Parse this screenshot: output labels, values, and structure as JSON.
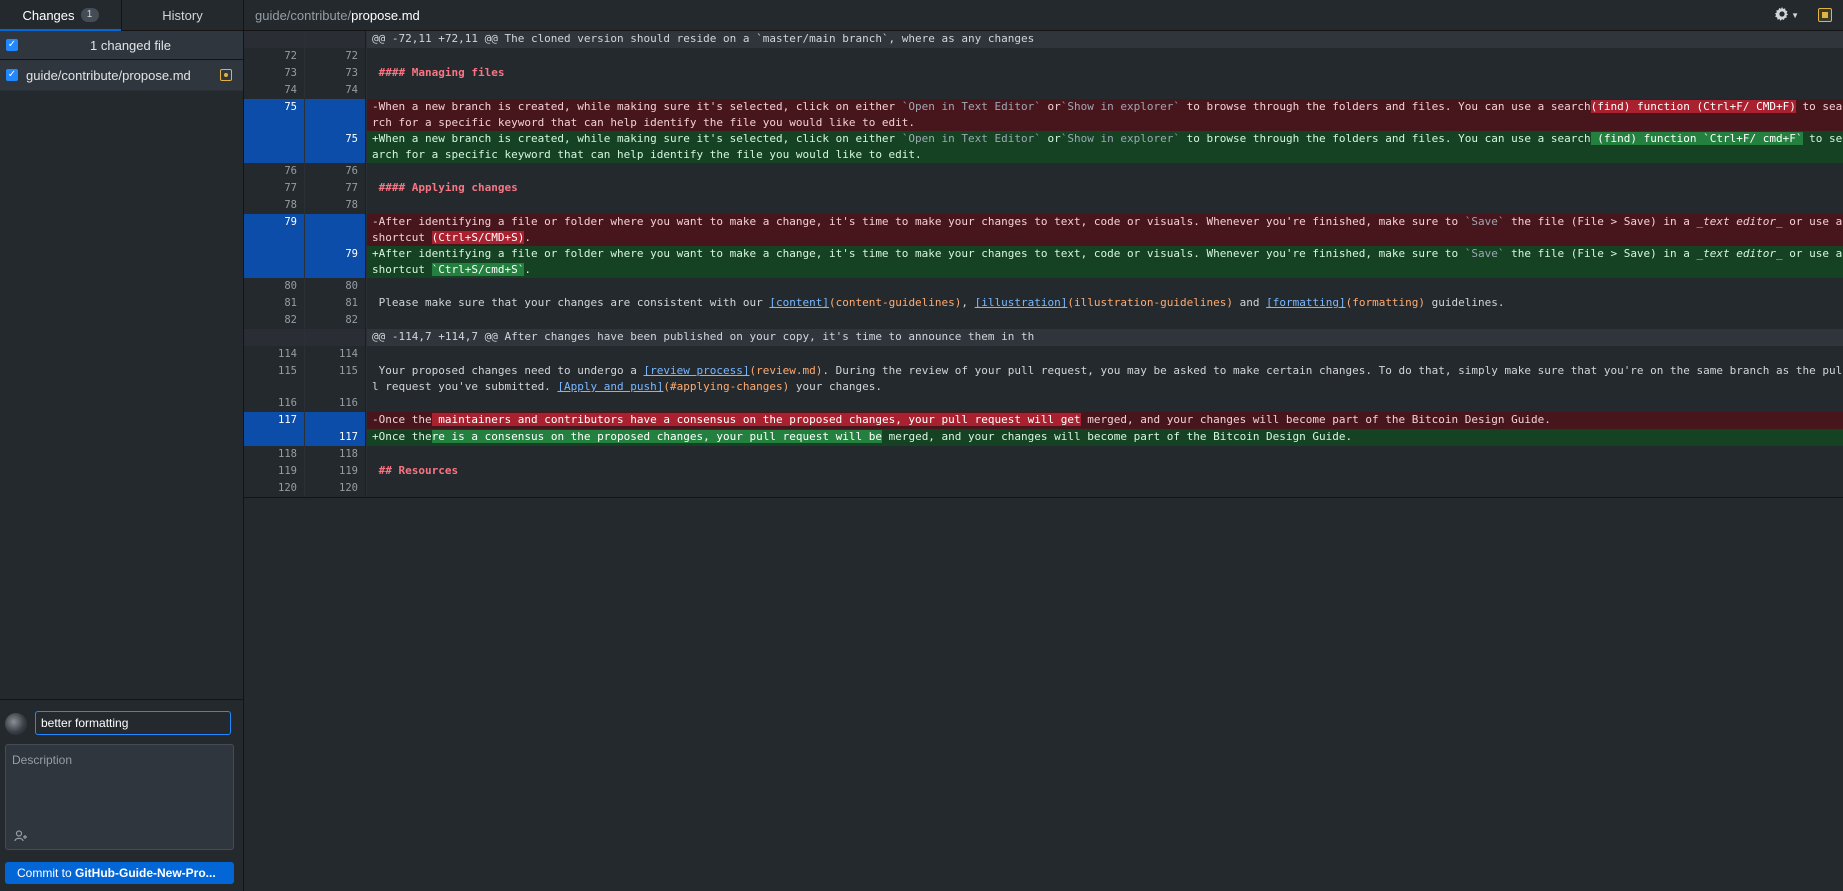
{
  "sidebar": {
    "tabs": [
      {
        "label": "Changes",
        "badge": "1",
        "active": true
      },
      {
        "label": "History",
        "active": false
      }
    ],
    "changed_files_label": "1 changed file",
    "files": [
      {
        "path": "guide/contribute/propose.md",
        "checked": true,
        "status": "modified"
      }
    ],
    "commit": {
      "summary_value": "better formatting",
      "description_placeholder": "Description",
      "button_prefix": "Commit to ",
      "button_branch": "GitHub-Guide-New-Pro..."
    }
  },
  "header": {
    "path_dir": "guide/contribute/",
    "path_file": "propose.md",
    "icons": [
      "gear-icon",
      "chevron-down-icon",
      "whitespace-toggle-icon"
    ]
  },
  "colors": {
    "accent": "#0366d6",
    "deleted_bg": "#47161d",
    "added_bg": "#144223",
    "selected_line": "#0b4da8"
  },
  "diff": [
    {
      "type": "hunk",
      "old": "",
      "new": "",
      "segs": [
        {
          "t": "@@ -72,11 +72,11 @@ The cloned version should reside on a `master/main branch`, where as any changes"
        }
      ]
    },
    {
      "type": "ctx",
      "old": "72",
      "new": "72",
      "segs": []
    },
    {
      "type": "ctx",
      "old": "73",
      "new": "73",
      "segs": [
        {
          "t": " "
        },
        {
          "t": "#### Managing files",
          "c": "md-h"
        }
      ]
    },
    {
      "type": "ctx",
      "old": "74",
      "new": "74",
      "segs": []
    },
    {
      "type": "del",
      "old": "75",
      "new": "",
      "sel": true,
      "segs": [
        {
          "t": "-When a new branch is created, while making sure it's selected, click on either "
        },
        {
          "t": "`Open in Text Editor`",
          "c": "md-code"
        },
        {
          "t": " or"
        },
        {
          "t": "`Show in explorer`",
          "c": "md-code"
        },
        {
          "t": " to browse through the folders and files. You can use a search"
        },
        {
          "t": "(find) function (Ctrl+F/ CMD+F)",
          "c": "hl-del"
        },
        {
          "t": " to search for a specific keyword that can help identify the file you would like to edit."
        }
      ]
    },
    {
      "type": "add",
      "old": "",
      "new": "75",
      "sel": true,
      "segs": [
        {
          "t": "+When a new branch is created, while making sure it's selected, click on either "
        },
        {
          "t": "`Open in Text Editor`",
          "c": "md-code"
        },
        {
          "t": " or"
        },
        {
          "t": "`Show in explorer`",
          "c": "md-code"
        },
        {
          "t": " to browse through the folders and files. You can use a search"
        },
        {
          "t": " (find) function `Ctrl+F/ cmd+F`",
          "c": "hl-add"
        },
        {
          "t": " to search for a specific keyword that can help identify the file you would like to edit."
        }
      ]
    },
    {
      "type": "ctx",
      "old": "76",
      "new": "76",
      "segs": []
    },
    {
      "type": "ctx",
      "old": "77",
      "new": "77",
      "segs": [
        {
          "t": " "
        },
        {
          "t": "#### Applying changes",
          "c": "md-h"
        }
      ]
    },
    {
      "type": "ctx",
      "old": "78",
      "new": "78",
      "segs": []
    },
    {
      "type": "del",
      "old": "79",
      "new": "",
      "sel": true,
      "segs": [
        {
          "t": "-After identifying a file or folder where you want to make a change, it's time to make your changes to text, code or visuals. Whenever you're finished, make sure to "
        },
        {
          "t": "`Save`",
          "c": "md-code"
        },
        {
          "t": " the file (File > Save) in a "
        },
        {
          "t": "_text editor_",
          "c": "md-em"
        },
        {
          "t": " or use a shortcut "
        },
        {
          "t": "(Ctrl+S/CMD+S)",
          "c": "hl-del"
        },
        {
          "t": "."
        }
      ]
    },
    {
      "type": "add",
      "old": "",
      "new": "79",
      "sel": true,
      "segs": [
        {
          "t": "+After identifying a file or folder where you want to make a change, it's time to make your changes to text, code or visuals. Whenever you're finished, make sure to "
        },
        {
          "t": "`Save`",
          "c": "md-code"
        },
        {
          "t": " the file (File > Save) in a "
        },
        {
          "t": "_text editor_",
          "c": "md-em"
        },
        {
          "t": " or use a shortcut "
        },
        {
          "t": "`Ctrl+S/cmd+S`",
          "c": "hl-add"
        },
        {
          "t": "."
        }
      ]
    },
    {
      "type": "ctx",
      "old": "80",
      "new": "80",
      "segs": []
    },
    {
      "type": "ctx",
      "old": "81",
      "new": "81",
      "segs": [
        {
          "t": " Please make sure that your changes are consistent with our "
        },
        {
          "t": "[content]",
          "c": "md-link"
        },
        {
          "t": "(content-guidelines)",
          "c": "md-url"
        },
        {
          "t": ", "
        },
        {
          "t": "[illustration]",
          "c": "md-link"
        },
        {
          "t": "(illustration-guidelines)",
          "c": "md-url"
        },
        {
          "t": " and "
        },
        {
          "t": "[formatting]",
          "c": "md-link"
        },
        {
          "t": "(formatting)",
          "c": "md-url"
        },
        {
          "t": " guidelines."
        }
      ]
    },
    {
      "type": "ctx",
      "old": "82",
      "new": "82",
      "segs": []
    },
    {
      "type": "hunk",
      "old": "",
      "new": "",
      "segs": [
        {
          "t": "@@ -114,7 +114,7 @@ After changes have been published on your copy, it's time to announce them in th"
        }
      ]
    },
    {
      "type": "ctx",
      "old": "114",
      "new": "114",
      "segs": []
    },
    {
      "type": "ctx",
      "old": "115",
      "new": "115",
      "segs": [
        {
          "t": " Your proposed changes need to undergo a "
        },
        {
          "t": "[review process]",
          "c": "md-link"
        },
        {
          "t": "(review.md)",
          "c": "md-url"
        },
        {
          "t": ". During the review of your pull request, you may be asked to make certain changes. To do that, simply make sure that you're on the same branch as the pull request you've submitted. "
        },
        {
          "t": "[Apply and push]",
          "c": "md-link"
        },
        {
          "t": "(#applying-changes)",
          "c": "md-url"
        },
        {
          "t": " your changes."
        }
      ]
    },
    {
      "type": "ctx",
      "old": "116",
      "new": "116",
      "segs": []
    },
    {
      "type": "del",
      "old": "117",
      "new": "",
      "sel": true,
      "segs": [
        {
          "t": "-Once the"
        },
        {
          "t": " maintainers and contributors have a consensus on the proposed changes, your pull request will get",
          "c": "hl-del"
        },
        {
          "t": " merged, and your changes will become part of the Bitcoin Design Guide."
        }
      ]
    },
    {
      "type": "add",
      "old": "",
      "new": "117",
      "sel": true,
      "segs": [
        {
          "t": "+Once the"
        },
        {
          "t": "re is a consensus on the proposed changes, your pull request will be",
          "c": "hl-add"
        },
        {
          "t": " merged, and your changes will become part of the Bitcoin Design Guide."
        }
      ]
    },
    {
      "type": "ctx",
      "old": "118",
      "new": "118",
      "segs": []
    },
    {
      "type": "ctx",
      "old": "119",
      "new": "119",
      "segs": [
        {
          "t": " "
        },
        {
          "t": "## Resources",
          "c": "md-h"
        }
      ]
    },
    {
      "type": "ctx",
      "old": "120",
      "new": "120",
      "segs": []
    }
  ]
}
